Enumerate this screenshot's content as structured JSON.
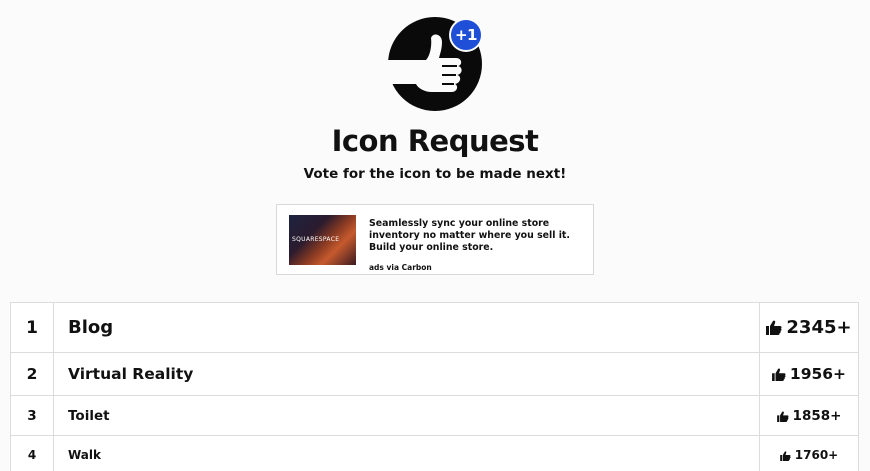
{
  "header": {
    "badge": "+1",
    "title": "Icon Request",
    "subtitle": "Vote for the icon to be made next!"
  },
  "ad": {
    "brand": "SQUARESPACE",
    "text": "Seamlessly sync your online store inventory no matter where you sell it. Build your online store.",
    "via": "ads via Carbon"
  },
  "requests": [
    {
      "rank": "1",
      "name": "Blog",
      "votes": "2345+"
    },
    {
      "rank": "2",
      "name": "Virtual Reality",
      "votes": "1956+"
    },
    {
      "rank": "3",
      "name": "Toilet",
      "votes": "1858+"
    },
    {
      "rank": "4",
      "name": "Walk",
      "votes": "1760+"
    }
  ],
  "icons": {
    "logo": "thumbs-up-circle-icon",
    "vote": "thumbs-up-icon"
  },
  "colors": {
    "badge": "#1f4fd6",
    "text": "#111111",
    "border": "#dcdcdc"
  }
}
